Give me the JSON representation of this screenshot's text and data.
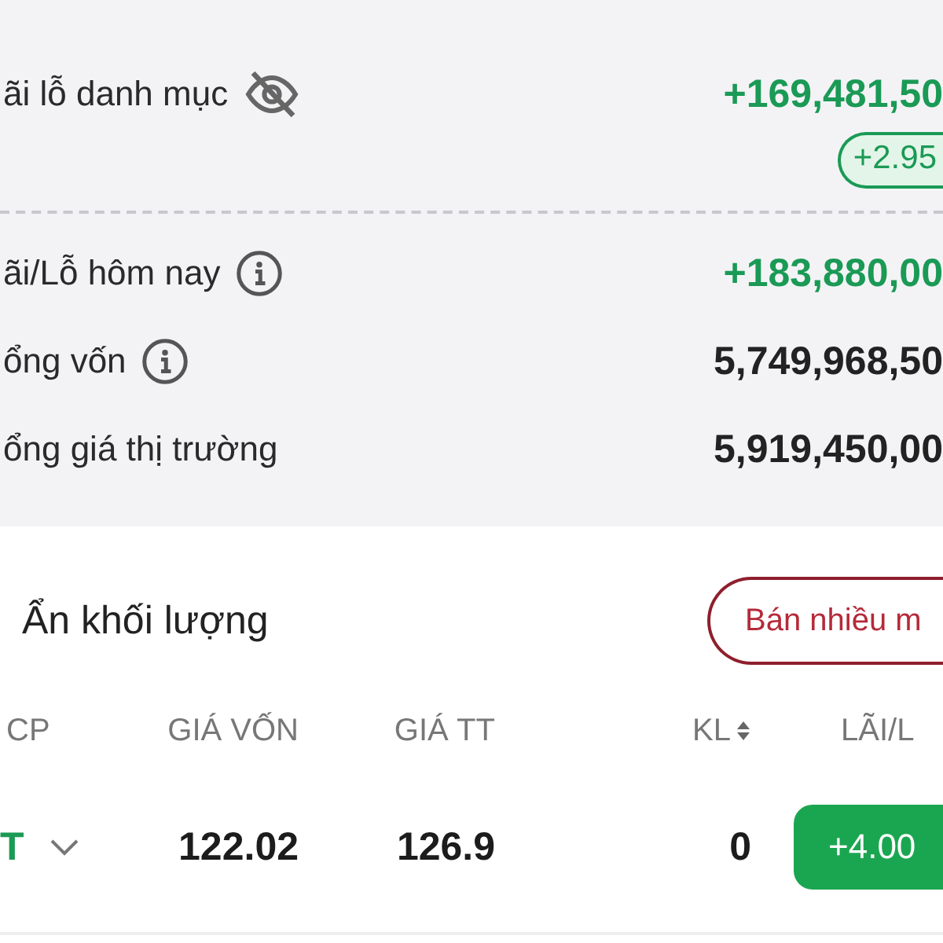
{
  "summary": {
    "title": "ãi lỗ danh mục",
    "value": "+169,481,50",
    "badge": "+2.95",
    "rows": [
      {
        "label": "ãi/Lỗ hôm nay",
        "info": true,
        "kind": "gain",
        "value": "+183,880,00"
      },
      {
        "label": "ổng vốn",
        "info": true,
        "kind": "plain",
        "value": "5,749,968,50"
      },
      {
        "label": "ổng giá thị trường",
        "info": false,
        "kind": "plain",
        "value": "5,919,450,00"
      }
    ]
  },
  "toolbar": {
    "hide_volume_label": "Ẩn khối lượng",
    "sell_button": "Bán nhiều m"
  },
  "table": {
    "columns": [
      "CP",
      "GIÁ VỐN",
      "GIÁ TT",
      "KL",
      "LÃI/L"
    ],
    "rows": [
      {
        "ticker": "T",
        "cost_price": "122.02",
        "market_price": "126.9",
        "volume": "0",
        "profit": "+4.00",
        "kind": "gain"
      }
    ]
  }
}
